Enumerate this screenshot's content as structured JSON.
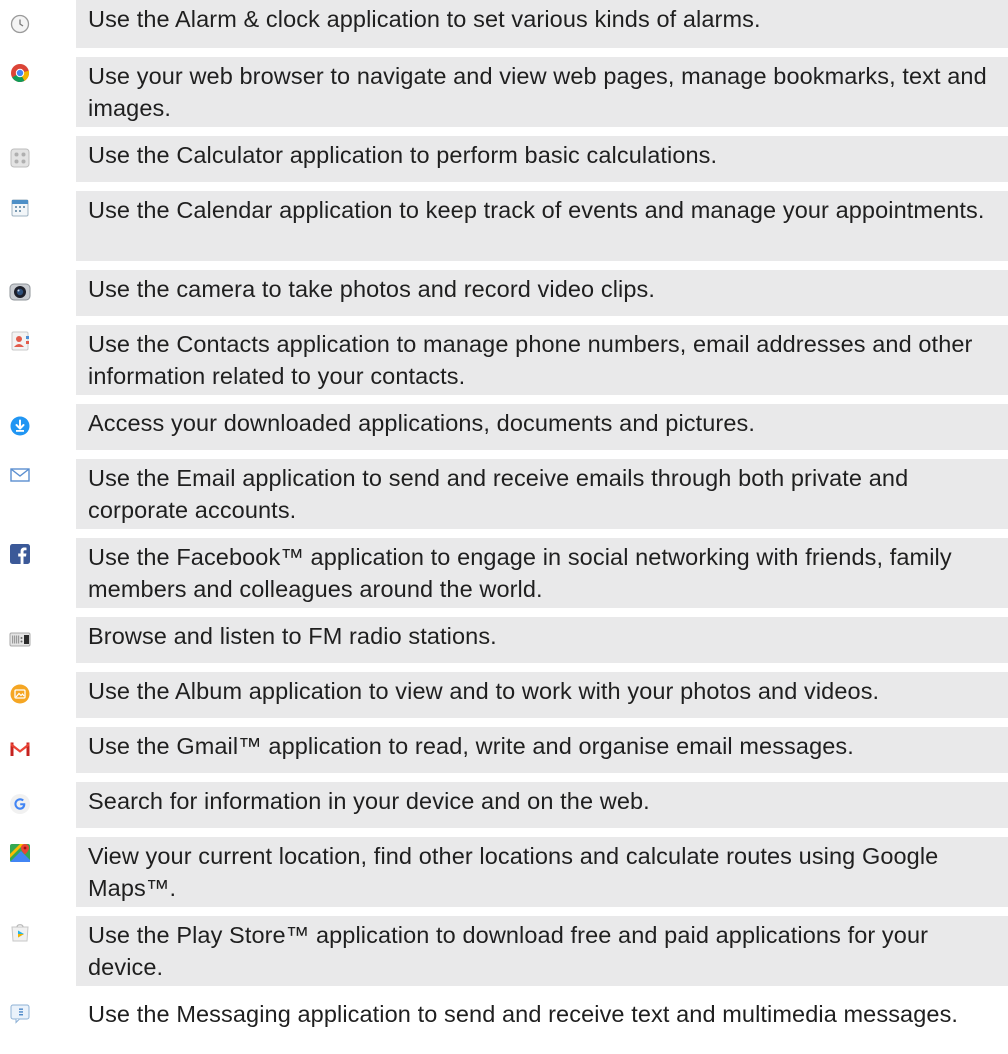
{
  "apps": [
    {
      "icon": "alarm-clock-icon",
      "text": "Use the Alarm & clock application to set various kinds of alarms."
    },
    {
      "icon": "chrome-browser-icon",
      "text": "Use your web browser to navigate and view web pages, manage bookmarks, text and images."
    },
    {
      "icon": "calculator-icon",
      "text": "Use the Calculator application to perform basic calculations."
    },
    {
      "icon": "calendar-icon",
      "text": "Use the Calendar application to keep track of events and manage your appointments."
    },
    {
      "icon": "camera-icon",
      "text": "Use the camera to take photos and record video clips."
    },
    {
      "icon": "contacts-icon",
      "text": "Use the Contacts application to manage phone numbers, email addresses and other information related to your contacts."
    },
    {
      "icon": "download-icon",
      "text": "Access your downloaded applications, documents and pictures."
    },
    {
      "icon": "email-icon",
      "text": "Use the Email application to send and receive emails through both private and corporate accounts."
    },
    {
      "icon": "facebook-icon",
      "text": "Use the Facebook™ application to engage in social networking with friends, family members and colleagues around the world."
    },
    {
      "icon": "fm-radio-icon",
      "text": "Browse and listen to FM radio stations."
    },
    {
      "icon": "album-icon",
      "text": "Use the Album application to view and to work with your photos and videos."
    },
    {
      "icon": "gmail-icon",
      "text": "Use the Gmail™ application to read, write and organise email messages."
    },
    {
      "icon": "google-search-icon",
      "text": "Search for information in your device and on the web."
    },
    {
      "icon": "google-maps-icon",
      "text": "View your current location, find other locations and calculate routes using Google Maps™."
    },
    {
      "icon": "play-store-icon",
      "text": "Use the Play Store™ application to download free and paid applications for your device."
    },
    {
      "icon": "messaging-icon",
      "text": "Use the Messaging application to send and receive text and multimedia messages."
    }
  ]
}
